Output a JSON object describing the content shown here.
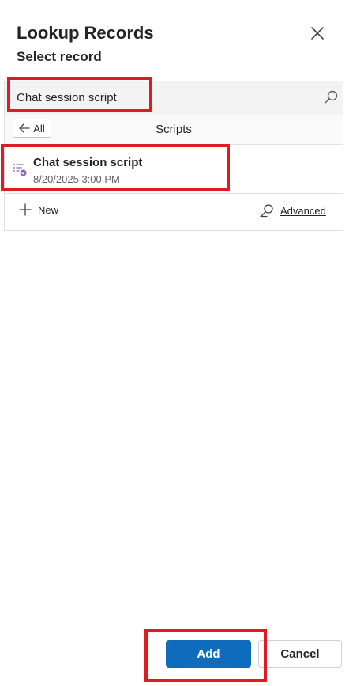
{
  "dialog": {
    "title": "Lookup Records",
    "subtitle": "Select record"
  },
  "search": {
    "value": "Chat session script",
    "icon": "search-icon"
  },
  "filter": {
    "back_label": "All",
    "entity_label": "Scripts"
  },
  "results": [
    {
      "name": "Chat session script",
      "date": "8/20/2025 3:00 PM",
      "icon": "script-icon"
    }
  ],
  "footer_actions": {
    "new_label": "New",
    "advanced_label": "Advanced"
  },
  "buttons": {
    "add_label": "Add",
    "cancel_label": "Cancel"
  },
  "colors": {
    "primary": "#0f6cbd",
    "highlight": "#e01b22",
    "icon_accent": "#8764b8"
  }
}
